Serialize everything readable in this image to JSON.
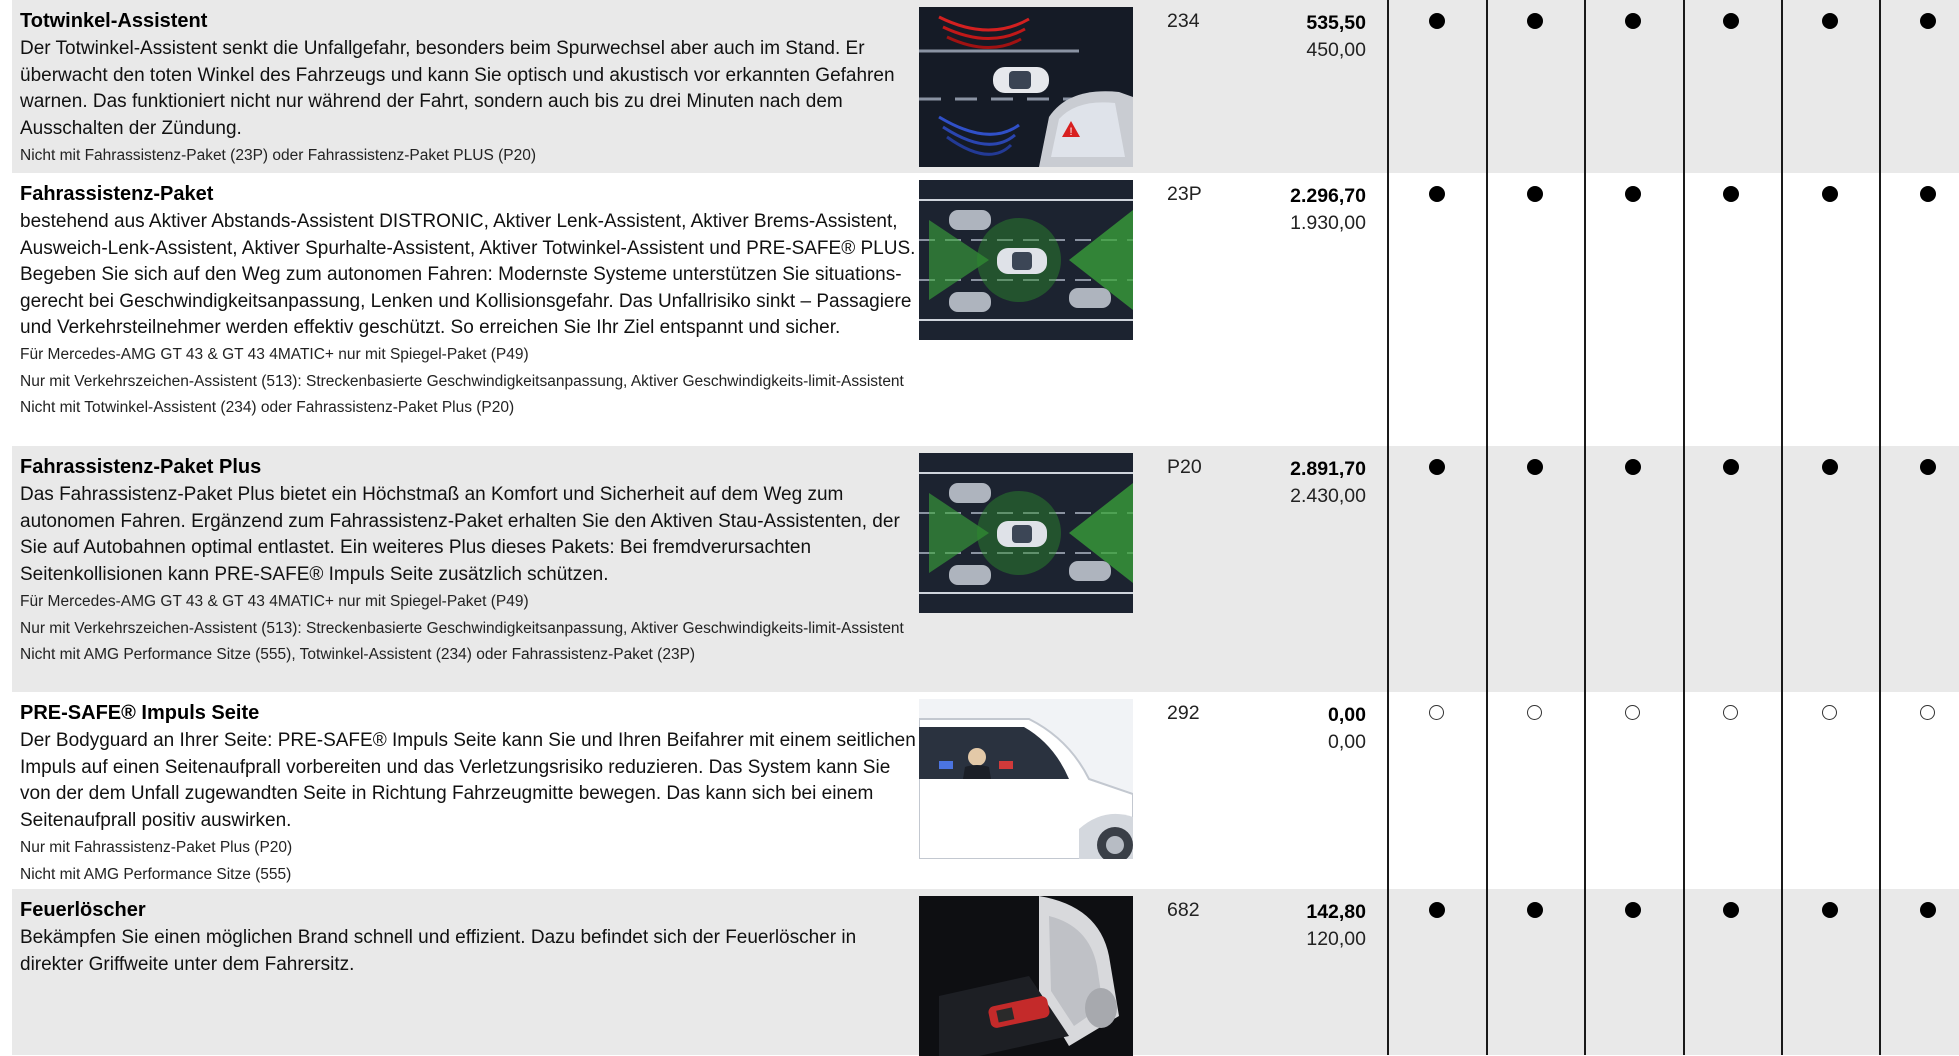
{
  "rows": [
    {
      "title": "Totwinkel-Assistent",
      "desc": "Der Totwinkel-Assistent senkt die Unfallgefahr, besonders beim Spurwechsel aber auch im Stand. Er überwacht den toten Winkel des Fahrzeugs und kann Sie optisch und akustisch vor erkannten Gefahren warnen. Das funktioniert nicht nur während der Fahrt, sondern auch bis zu drei Minuten nach dem Ausschalten der Zündung.",
      "notes": [
        "Nicht mit Fahrassistenz-Paket (23P) oder Fahrassistenz-Paket PLUS (P20)"
      ],
      "code": "234",
      "price_gross": "535,50",
      "price_net": "450,00",
      "marks": [
        "full",
        "full",
        "full",
        "full",
        "full",
        "full"
      ],
      "image": "blind-spot-assist-image"
    },
    {
      "title": "Fahrassistenz-Paket",
      "desc": "bestehend aus Aktiver Abstands-Assistent DISTRONIC, Aktiver Lenk-Assistent, Aktiver Brems-Assistent, Ausweich-Lenk-Assistent, Aktiver Spurhalte-Assistent, Aktiver Totwinkel-Assistent und PRE-SAFE® PLUS. Begeben Sie sich auf den Weg zum autonomen Fahren: Modernste Systeme unterstützen Sie situations­gerecht bei Geschwindigkeitsanpassung, Lenken und Kollisionsgefahr. Das Unfallrisiko sinkt – Passagiere und Verkehrsteilnehmer werden effektiv geschützt. So erreichen Sie Ihr Ziel entspannt und sicher.",
      "notes": [
        "Für Mercedes-AMG GT 43 & GT 43 4MATIC+ nur mit Spiegel-Paket (P49)",
        "Nur mit Verkehrszeichen-Assistent (513): Streckenbasierte Geschwindigkeitsanpassung, Aktiver Geschwindigkeits-limit-Assistent",
        "Nicht mit Totwinkel-Assistent (234) oder Fahrassistenz-Paket Plus (P20)"
      ],
      "code": "23P",
      "price_gross": "2.296,70",
      "price_net": "1.930,00",
      "marks": [
        "full",
        "full",
        "full",
        "full",
        "full",
        "full"
      ],
      "image": "driving-assistance-package-image"
    },
    {
      "title": "Fahrassistenz-Paket Plus",
      "desc": "Das Fahrassistenz-Paket Plus bietet ein Höchstmaß an Komfort und Sicherheit auf dem Weg zum autonomen Fahren. Ergänzend zum Fahrassistenz-Paket erhalten Sie den Aktiven Stau-Assistenten, der Sie auf Autobahnen optimal entlastet. Ein weiteres Plus dieses Pakets: Bei fremdverursachten Seitenkollisionen kann PRE-SAFE® Impuls Seite zusätzlich schützen.",
      "notes": [
        "Für Mercedes-AMG GT 43 & GT 43 4MATIC+ nur mit Spiegel-Paket (P49)",
        "Nur mit Verkehrszeichen-Assistent (513): Streckenbasierte Geschwindigkeitsanpassung, Aktiver Geschwindigkeits-limit-Assistent",
        "Nicht mit AMG Performance Sitze (555), Totwinkel-Assistent (234) oder Fahrassistenz-Paket (23P)"
      ],
      "code": "P20",
      "price_gross": "2.891,70",
      "price_net": "2.430,00",
      "marks": [
        "full",
        "full",
        "full",
        "full",
        "full",
        "full"
      ],
      "image": "driving-assistance-package-plus-image"
    },
    {
      "title": "PRE-SAFE® Impuls Seite",
      "desc": "Der Bodyguard an Ihrer Seite: PRE-SAFE® Impuls Seite kann Sie und Ihren Beifahrer mit einem seitlichen Impuls auf einen Seitenaufprall vorbereiten und das Verletzungsrisiko reduzieren. Das System kann Sie von der dem Unfall zugewandten Seite in Richtung Fahrzeugmitte bewegen. Das kann sich bei einem Seitenaufprall positiv auswirken.",
      "notes": [
        "Nur mit Fahrassistenz-Paket Plus (P20)",
        "Nicht mit AMG Performance Sitze (555)"
      ],
      "code": "292",
      "price_gross": "0,00",
      "price_net": "0,00",
      "marks": [
        "empty",
        "empty",
        "empty",
        "empty",
        "empty",
        "empty"
      ],
      "image": "pre-safe-impulse-side-image"
    },
    {
      "title": "Feuerlöscher",
      "desc": "Bekämpfen Sie einen möglichen Brand schnell und effizient. Dazu befindet sich der Feuerlöscher in direkter Griffweite unter dem Fahrersitz.",
      "notes": [],
      "code": "682",
      "price_gross": "142,80",
      "price_net": "120,00",
      "marks": [
        "full",
        "full",
        "full",
        "full",
        "full",
        "full"
      ],
      "image": "fire-extinguisher-image"
    }
  ]
}
